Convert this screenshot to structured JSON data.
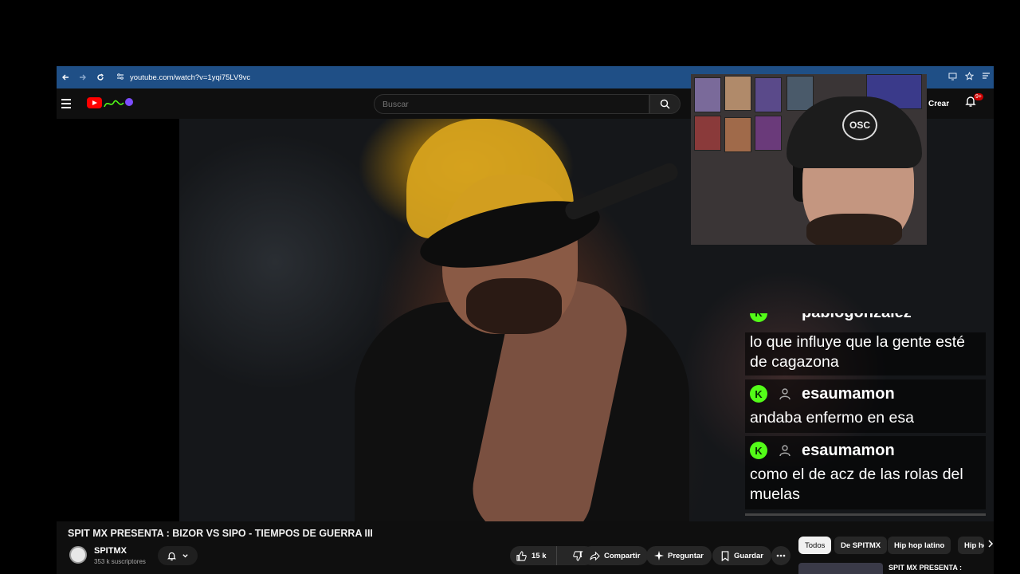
{
  "browser": {
    "url": "youtube.com/watch?v=1yqi75LV9vc",
    "back_icon": "arrow-left-icon",
    "forward_icon": "arrow-right-icon",
    "reload_icon": "reload-icon"
  },
  "header": {
    "search_placeholder": "Buscar",
    "create_label": "Crear",
    "notification_badge": "9+"
  },
  "webcam": {
    "cap_logo_text": "OSC"
  },
  "chat": {
    "partial_username": "pablogonzalez",
    "messages": [
      {
        "username": "",
        "text": "lo que influye que la gente esté de cagazona"
      },
      {
        "username": "esaumamon",
        "text": "andaba enfermo en esa"
      },
      {
        "username": "esaumamon",
        "text": "como el de acz de las rolas del muelas"
      }
    ]
  },
  "video": {
    "title": "SPIT MX PRESENTA : BIZOR VS SIPO - TIEMPOS DE GUERRA III",
    "channel_name": "SPITMX",
    "subscribers": "353 k suscriptores",
    "likes": "15 k",
    "share_label": "Compartir",
    "ask_label": "Preguntar",
    "save_label": "Guardar"
  },
  "chips": [
    "Todos",
    "De SPITMX",
    "Hip hop latino",
    "Hip hop"
  ],
  "recommendation": {
    "title": "SPIT MX PRESENTA :"
  },
  "colors": {
    "kick_green": "#53fc18",
    "youtube_red": "#ff0000",
    "browser_blue": "#1f4f86"
  }
}
